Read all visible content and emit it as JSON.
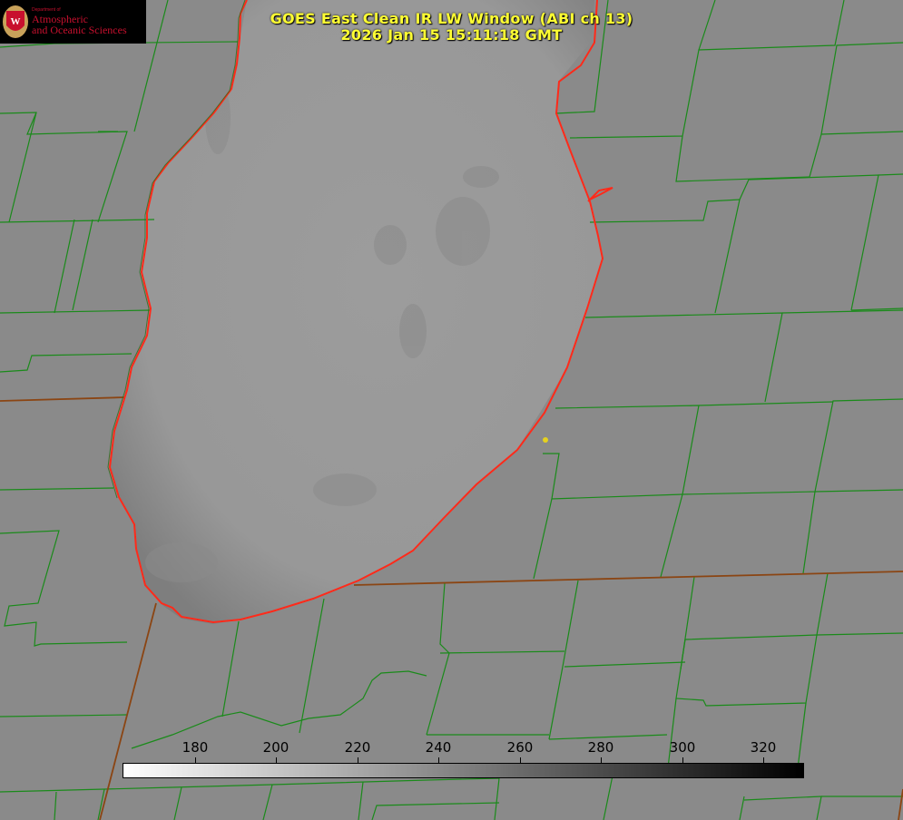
{
  "title": {
    "line1": "GOES East Clean IR LW Window (ABI ch 13)",
    "line2": "2026 Jan 15 15:11:18 GMT"
  },
  "logo": {
    "department": "Department of",
    "line1": "Atmospheric",
    "line2": "and Oceanic Sciences",
    "brand_color": "#c8102e",
    "icon": "uw-crest-icon"
  },
  "colorbar": {
    "tick_labels": [
      "180",
      "200",
      "220",
      "240",
      "260",
      "280",
      "300",
      "320"
    ],
    "min_color": "#ffffff",
    "max_color": "#000000"
  },
  "colors": {
    "title": "#ffff33",
    "county_lines": "#1a8a1a",
    "state_lines": "#8b4513",
    "shoreline": "#ff2a1a",
    "marker": "#e6d21e",
    "land": "#8a8a8a",
    "lake": "#999999"
  }
}
